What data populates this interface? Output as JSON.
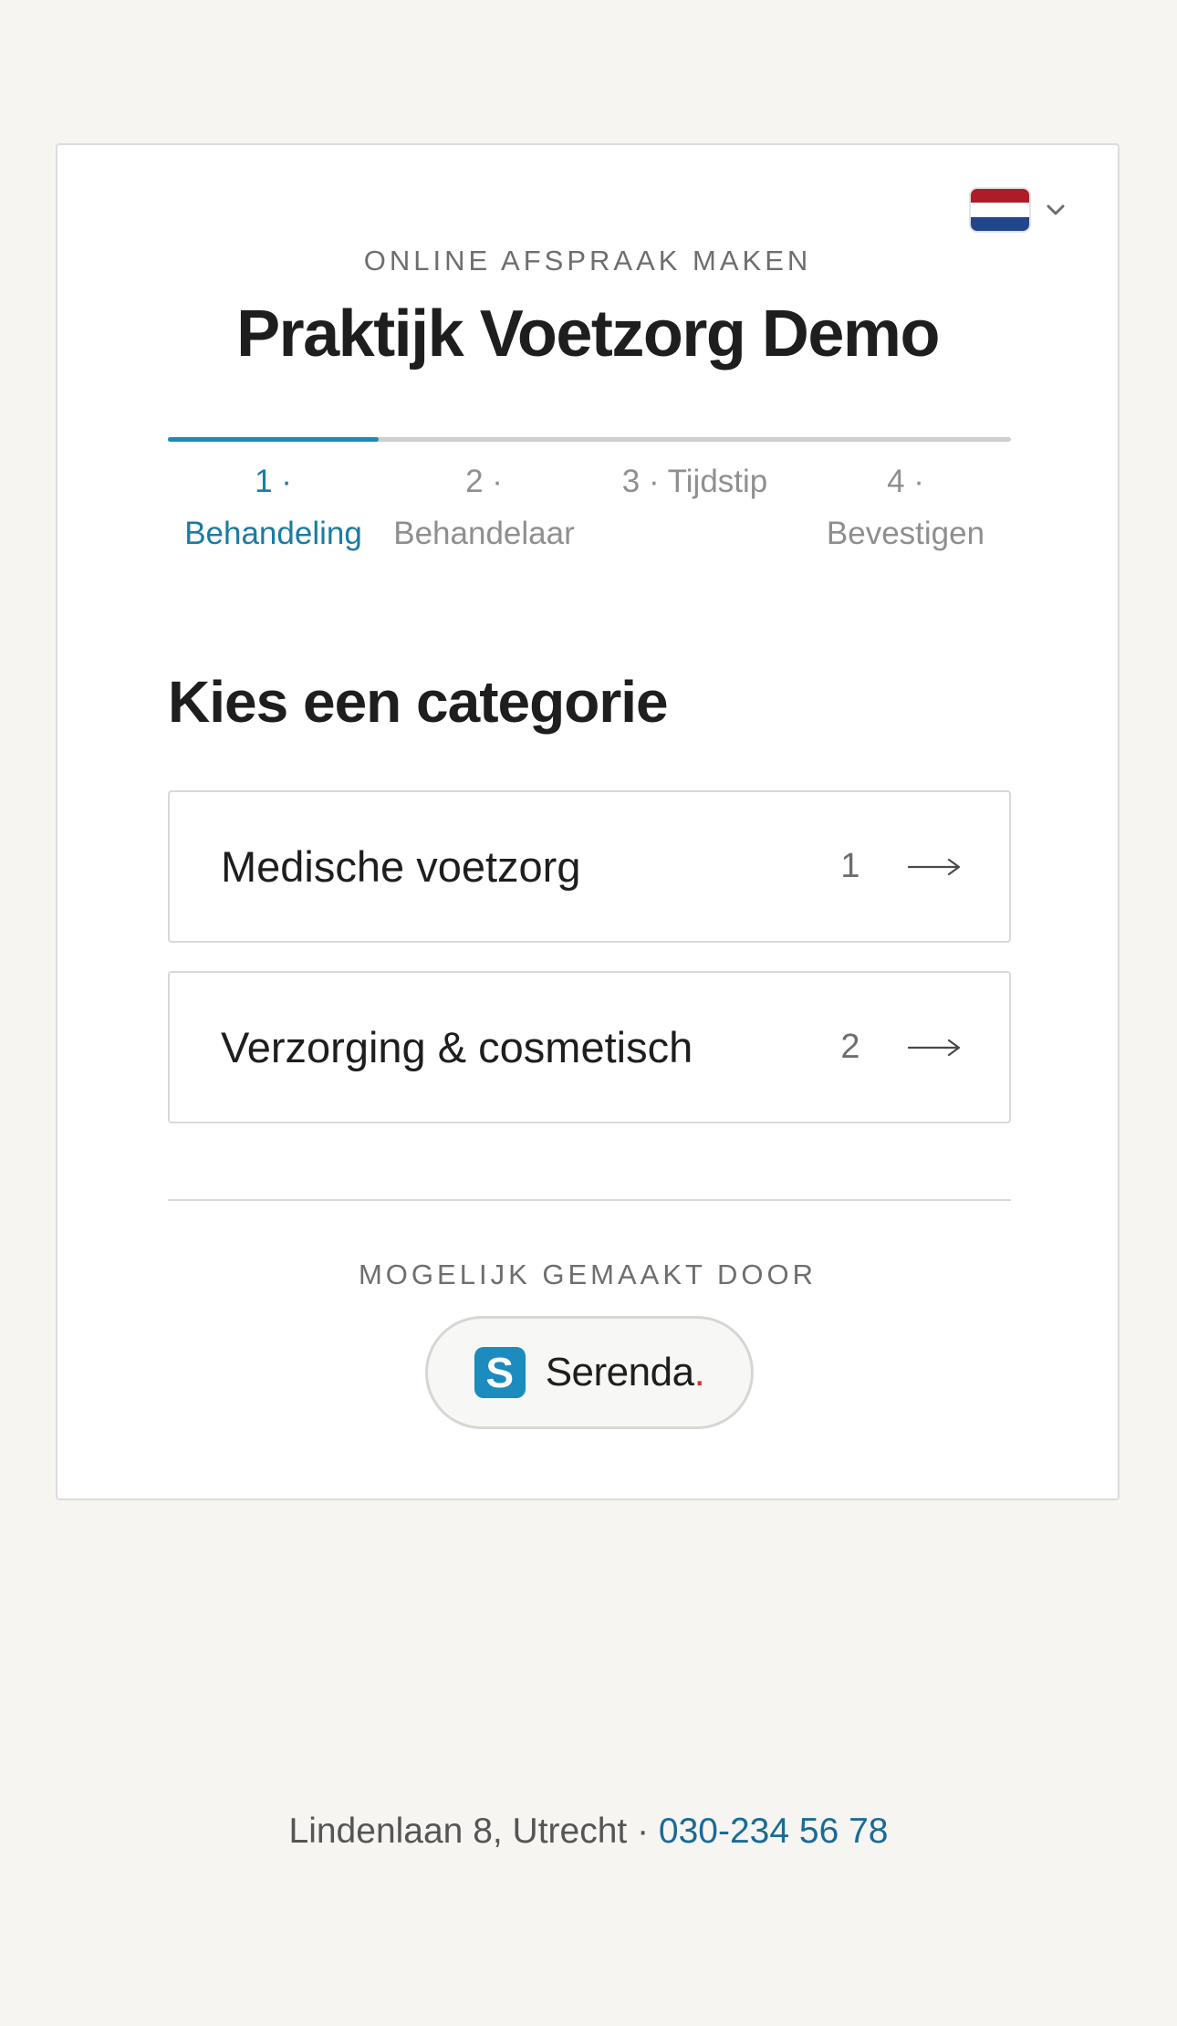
{
  "language": {
    "flag_icon": "netherlands-flag-icon",
    "chevron_icon": "chevron-down-icon"
  },
  "header": {
    "eyebrow": "ONLINE AFSPRAAK MAKEN",
    "title": "Praktijk Voetzorg Demo"
  },
  "progress": {
    "fraction": 0.25,
    "accent": "#1f8ab6"
  },
  "steps": [
    {
      "num": "1 ·",
      "label": "Behandeling"
    },
    {
      "num": "2 ·",
      "label": "Behandelaar"
    },
    {
      "num": "3 · Tijdstip",
      "label": ""
    },
    {
      "num": "4 ·",
      "label": "Bevestigen"
    }
  ],
  "heading": "Kies een categorie",
  "categories": [
    {
      "name": "Medische voetzorg",
      "count": "1",
      "icon": "arrow-right-icon"
    },
    {
      "name": "Verzorging & cosmetisch",
      "count": "2",
      "icon": "arrow-right-icon"
    }
  ],
  "powered_by": {
    "label": "MOGELIJK GEMAAKT DOOR",
    "logo_letter": "S",
    "brand": "Serenda",
    "brand_dot": "."
  },
  "footer": {
    "address": "Lindenlaan 8, Utrecht · ",
    "phone": "030-234 56 78"
  }
}
